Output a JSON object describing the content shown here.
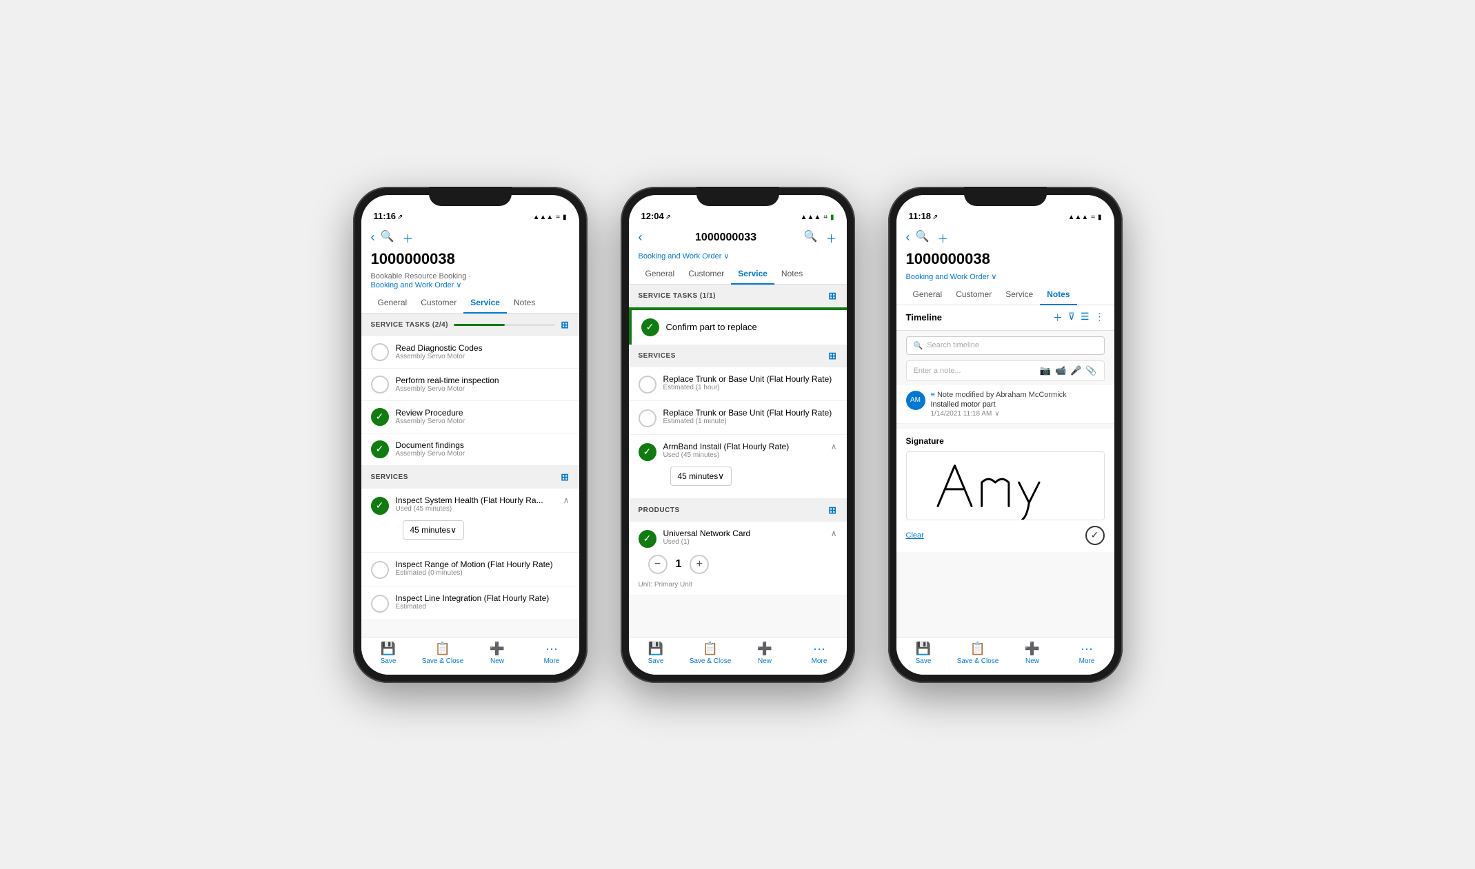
{
  "scene": {
    "background": "#e8e8e8"
  },
  "phone1": {
    "status": {
      "time": "11:16",
      "signal": "▲▲▲",
      "wifi": "WiFi",
      "battery": "Battery"
    },
    "title": "1000000038",
    "subtitle": "Bookable Resource Booking",
    "subtitle2": "Booking and Work Order",
    "tabs": [
      "General",
      "Customer",
      "Service",
      "Notes"
    ],
    "activeTab": "Service",
    "serviceTasks": {
      "label": "SERVICE TASKS (2/4)",
      "progress": 50,
      "items": [
        {
          "name": "Read Diagnostic Codes",
          "sub": "Assembly Servo Motor",
          "done": false
        },
        {
          "name": "Perform real-time inspection",
          "sub": "Assembly Servo Motor",
          "done": false
        },
        {
          "name": "Review Procedure",
          "sub": "Assembly Servo Motor",
          "done": true
        },
        {
          "name": "Document findings",
          "sub": "Assembly Servo Motor",
          "done": true
        }
      ]
    },
    "services": {
      "label": "SERVICES",
      "items": [
        {
          "name": "Inspect System Health (Flat Hourly Ra...",
          "sub": "Used (45 minutes)",
          "done": true,
          "expanded": true,
          "duration": "45 minutes"
        },
        {
          "name": "Inspect Range of Motion (Flat Hourly Rate)",
          "sub": "Estimated (0 minutes)",
          "done": false
        },
        {
          "name": "Inspect Line Integration (Flat Hourly Rate)",
          "sub": "Estimated",
          "done": false
        }
      ]
    },
    "toolbar": {
      "save": "Save",
      "saveClose": "Save & Close",
      "new": "New",
      "more": "More"
    }
  },
  "phone2": {
    "status": {
      "time": "12:04",
      "signal": "▲▲▲",
      "wifi": "WiFi",
      "battery": "Battery"
    },
    "title": "1000000033",
    "subtitle": "Booking and Work Order",
    "tabs": [
      "General",
      "Customer",
      "Service",
      "Notes"
    ],
    "activeTab": "Service",
    "serviceTasks": {
      "label": "SERVICE TASKS (1/1)",
      "items": [
        {
          "name": "Confirm part to replace",
          "done": true
        }
      ]
    },
    "services": {
      "label": "SERVICES",
      "items": [
        {
          "name": "Replace Trunk or Base Unit (Flat Hourly Rate)",
          "sub": "Estimated (1 hour)",
          "done": false
        },
        {
          "name": "Replace Trunk or Base Unit (Flat Hourly Rate)",
          "sub": "Estimated (1 minute)",
          "done": false
        },
        {
          "name": "ArmBand Install (Flat Hourly Rate)",
          "sub": "Used (45 minutes)",
          "done": true,
          "expanded": true,
          "duration": "45 minutes"
        }
      ]
    },
    "products": {
      "label": "PRODUCTS",
      "items": [
        {
          "name": "Universal Network Card",
          "sub": "Used (1)",
          "done": true,
          "expanded": true,
          "quantity": 1,
          "unit": "Unit: Primary Unit"
        }
      ]
    },
    "toolbar": {
      "save": "Save",
      "saveClose": "Save & Close",
      "new": "New",
      "more": "More"
    }
  },
  "phone3": {
    "status": {
      "time": "11:18",
      "signal": "▲▲▲",
      "wifi": "WiFi",
      "battery": "Battery"
    },
    "title": "1000000038",
    "subtitle": "Booking and Work Order",
    "tabs": [
      "General",
      "Customer",
      "Service",
      "Notes"
    ],
    "activeTab": "Notes",
    "timeline": {
      "title": "Timeline",
      "searchPlaceholder": "Search timeline",
      "notePlaceholder": "Enter a note...",
      "entry": {
        "author": "Note modified by Abraham McCormick",
        "text": "Installed motor part",
        "time": "1/14/2021 11:18 AM"
      }
    },
    "signature": {
      "label": "Signature",
      "clearLabel": "Clear"
    },
    "toolbar": {
      "save": "Save",
      "saveClose": "Save & Close",
      "new": "New",
      "more": "More"
    }
  }
}
